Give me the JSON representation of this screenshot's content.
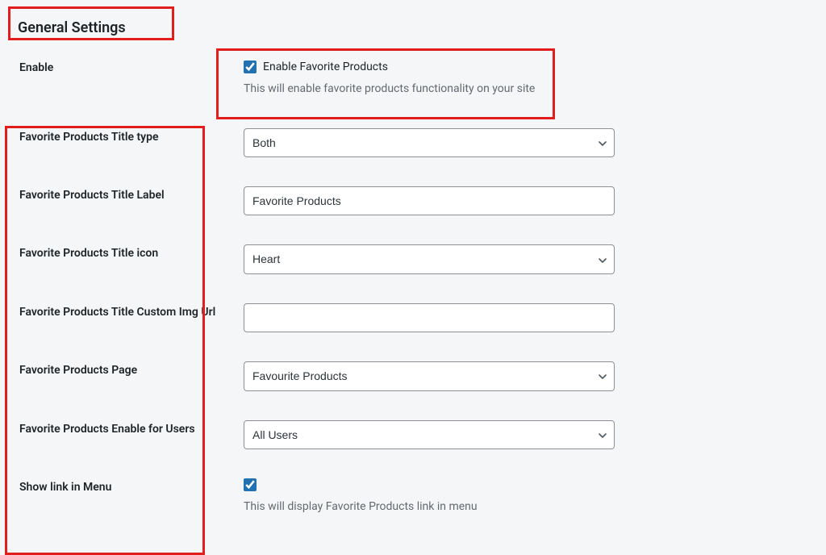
{
  "section": {
    "title": "General Settings"
  },
  "fields": {
    "enable": {
      "label": "Enable",
      "check_label": "Enable Favorite Products",
      "description": "This will enable favorite products functionality on your site",
      "checked": true
    },
    "title_type": {
      "label": "Favorite Products Title type",
      "value": "Both"
    },
    "title_label": {
      "label": "Favorite Products Title Label",
      "value": "Favorite Products"
    },
    "title_icon": {
      "label": "Favorite Products Title icon",
      "value": "Heart"
    },
    "custom_img": {
      "label": "Favorite Products Title Custom Img Url",
      "value": ""
    },
    "page": {
      "label": "Favorite Products Page",
      "value": "Favourite Products"
    },
    "users": {
      "label": "Favorite Products Enable for Users",
      "value": "All Users"
    },
    "menu": {
      "label": "Show link in Menu",
      "description": "This will display Favorite Products link in menu",
      "checked": true
    }
  }
}
